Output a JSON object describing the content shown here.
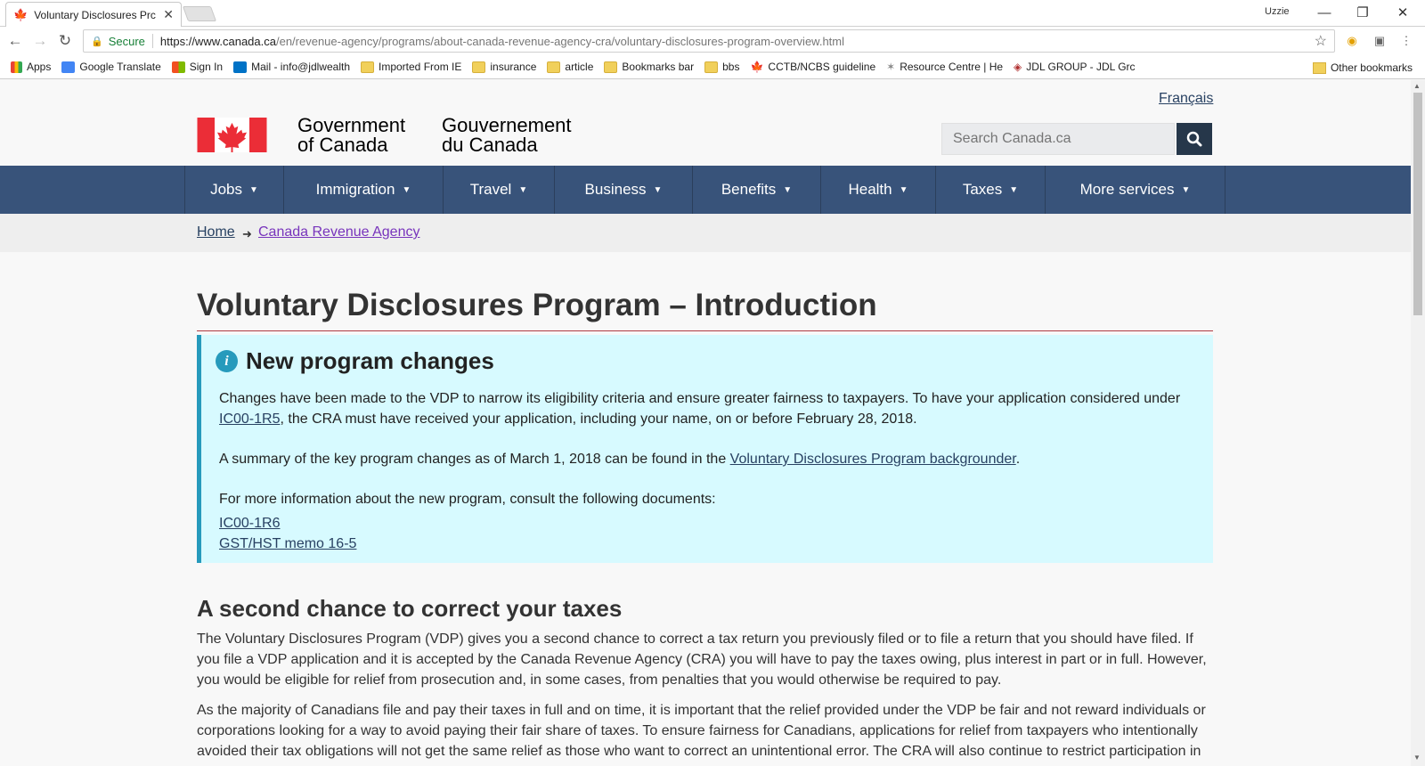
{
  "browser": {
    "tab_title": "Voluntary Disclosures Prc",
    "user": "Uzzie",
    "secure_label": "Secure",
    "url_host": "https://www.canada.ca",
    "url_path": "/en/revenue-agency/programs/about-canada-revenue-agency-cra/voluntary-disclosures-program-overview.html",
    "bookmarks": [
      "Apps",
      "Google Translate",
      "Sign In",
      "Mail - info@jdlwealth",
      "Imported From IE",
      "insurance",
      "article",
      "Bookmarks bar",
      "bbs",
      "CCTB/NCBS guideline",
      "Resource Centre | He",
      "JDL GROUP - JDL Grc"
    ],
    "other_bookmarks": "Other bookmarks"
  },
  "header": {
    "language_link": "Français",
    "wordmark_en_1": "Government",
    "wordmark_en_2": "of Canada",
    "wordmark_fr_1": "Gouvernement",
    "wordmark_fr_2": "du Canada",
    "search_placeholder": "Search Canada.ca"
  },
  "menu": [
    "Jobs",
    "Immigration",
    "Travel",
    "Business",
    "Benefits",
    "Health",
    "Taxes",
    "More services"
  ],
  "breadcrumb": {
    "home": "Home",
    "arrow": "➜",
    "cra": "Canada Revenue Agency"
  },
  "page_title": "Voluntary Disclosures Program – Introduction",
  "alert": {
    "heading": "New program changes",
    "p1_a": "Changes have been made to the VDP to narrow its eligibility criteria and ensure greater fairness to taxpayers. To have your application considered under",
    "p1_link": "IC00-1R5",
    "p1_b": ", the CRA must have received your application, including your name, on or before February 28, 2018.",
    "p2_a": "A summary of the key program changes as of March 1, 2018 can be found in the",
    "p2_link": "Voluntary Disclosures Program backgrounder",
    "p2_b": ".",
    "p3": "For more information about the new program, consult the following documents:",
    "link1": "IC00-1R6",
    "link2": "GST/HST memo 16-5"
  },
  "section": {
    "heading": "A second chance to correct your taxes",
    "p1": "The Voluntary Disclosures Program (VDP) gives you a second chance to correct a tax return you previously filed or to file a return that you should have filed. If you file a VDP application and it is accepted by the Canada Revenue Agency (CRA) you will have to pay the taxes owing, plus interest in part or in full. However, you would be eligible for relief from prosecution and, in some cases, from penalties that you would otherwise be required to pay.",
    "p2": "As the majority of Canadians file and pay their taxes in full and on time, it is important that the relief provided under the VDP be fair and not reward individuals or corporations looking for a way to avoid paying their fair share of taxes. To ensure fairness for Canadians, applications for relief from taxpayers who intentionally avoided their tax obligations will not get the same relief as those who want to correct an unintentional error. The CRA will also continue to restrict participation in"
  },
  "colors": {
    "menu_bg": "#38537a",
    "link": "#284162",
    "alert_bg": "#d7faff",
    "alert_border": "#269abc",
    "flag_red": "#eb2d37"
  }
}
